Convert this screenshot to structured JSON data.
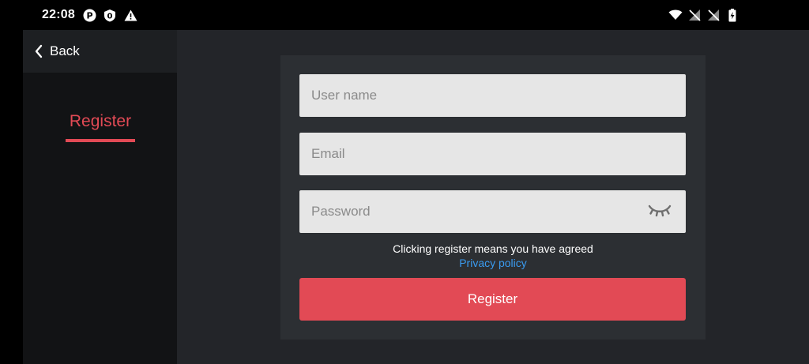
{
  "status_bar": {
    "time": "22:08",
    "left_icons": [
      "p-circle-icon",
      "shield-zero-icon",
      "warning-icon"
    ],
    "right_icons": [
      "wifi-icon",
      "no-sim-icon",
      "no-sim-icon",
      "battery-charging-icon"
    ]
  },
  "sidebar": {
    "back_label": "Back",
    "active_tab": "Register",
    "accent_color": "#e24a55"
  },
  "form": {
    "username_placeholder": "User name",
    "username_value": "",
    "email_placeholder": "Email",
    "email_value": "",
    "password_placeholder": "Password",
    "password_value": "",
    "agree_text": "Clicking register means you have agreed",
    "privacy_link": "Privacy policy",
    "register_button": "Register"
  }
}
